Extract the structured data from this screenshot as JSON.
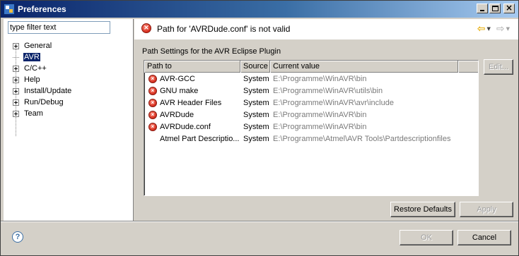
{
  "window": {
    "title": "Preferences"
  },
  "filter": {
    "placeholder": "type filter text"
  },
  "tree": {
    "items": [
      {
        "label": "General",
        "expandable": true
      },
      {
        "label": "AVR",
        "expandable": false,
        "selected": true
      },
      {
        "label": "C/C++",
        "expandable": true
      },
      {
        "label": "Help",
        "expandable": true
      },
      {
        "label": "Install/Update",
        "expandable": true
      },
      {
        "label": "Run/Debug",
        "expandable": true
      },
      {
        "label": "Team",
        "expandable": true
      }
    ]
  },
  "message": {
    "text": "Path for 'AVRDude.conf' is not valid",
    "icon": "error-icon"
  },
  "section": {
    "label": "Path Settings for the AVR Eclipse Plugin"
  },
  "table": {
    "columns": [
      "Path to",
      "Source",
      "Current value"
    ],
    "rows": [
      {
        "name": "AVR-GCC",
        "source": "System",
        "value": "E:\\Programme\\WinAVR\\bin",
        "error": true
      },
      {
        "name": "GNU make",
        "source": "System",
        "value": "E:\\Programme\\WinAVR\\utils\\bin",
        "error": true
      },
      {
        "name": "AVR Header Files",
        "source": "System",
        "value": "E:\\Programme\\WinAVR\\avr\\include",
        "error": true
      },
      {
        "name": "AVRDude",
        "source": "System",
        "value": "E:\\Programme\\WinAVR\\bin",
        "error": true
      },
      {
        "name": "AVRDude.conf",
        "source": "System",
        "value": "E:\\Programme\\WinAVR\\bin",
        "error": true
      },
      {
        "name": "Atmel Part Descriptio...",
        "source": "System",
        "value": "E:\\Programme\\Atmel\\AVR Tools\\Partdescriptionfiles",
        "error": false
      }
    ]
  },
  "buttons": {
    "edit": "Edit...",
    "restore_defaults": "Restore Defaults",
    "apply": "Apply",
    "ok": "OK",
    "cancel": "Cancel",
    "help": "?"
  },
  "colors": {
    "error_red": "#d42c1c",
    "selection": "#0a246a",
    "disabled_text": "#a0a0a0"
  }
}
